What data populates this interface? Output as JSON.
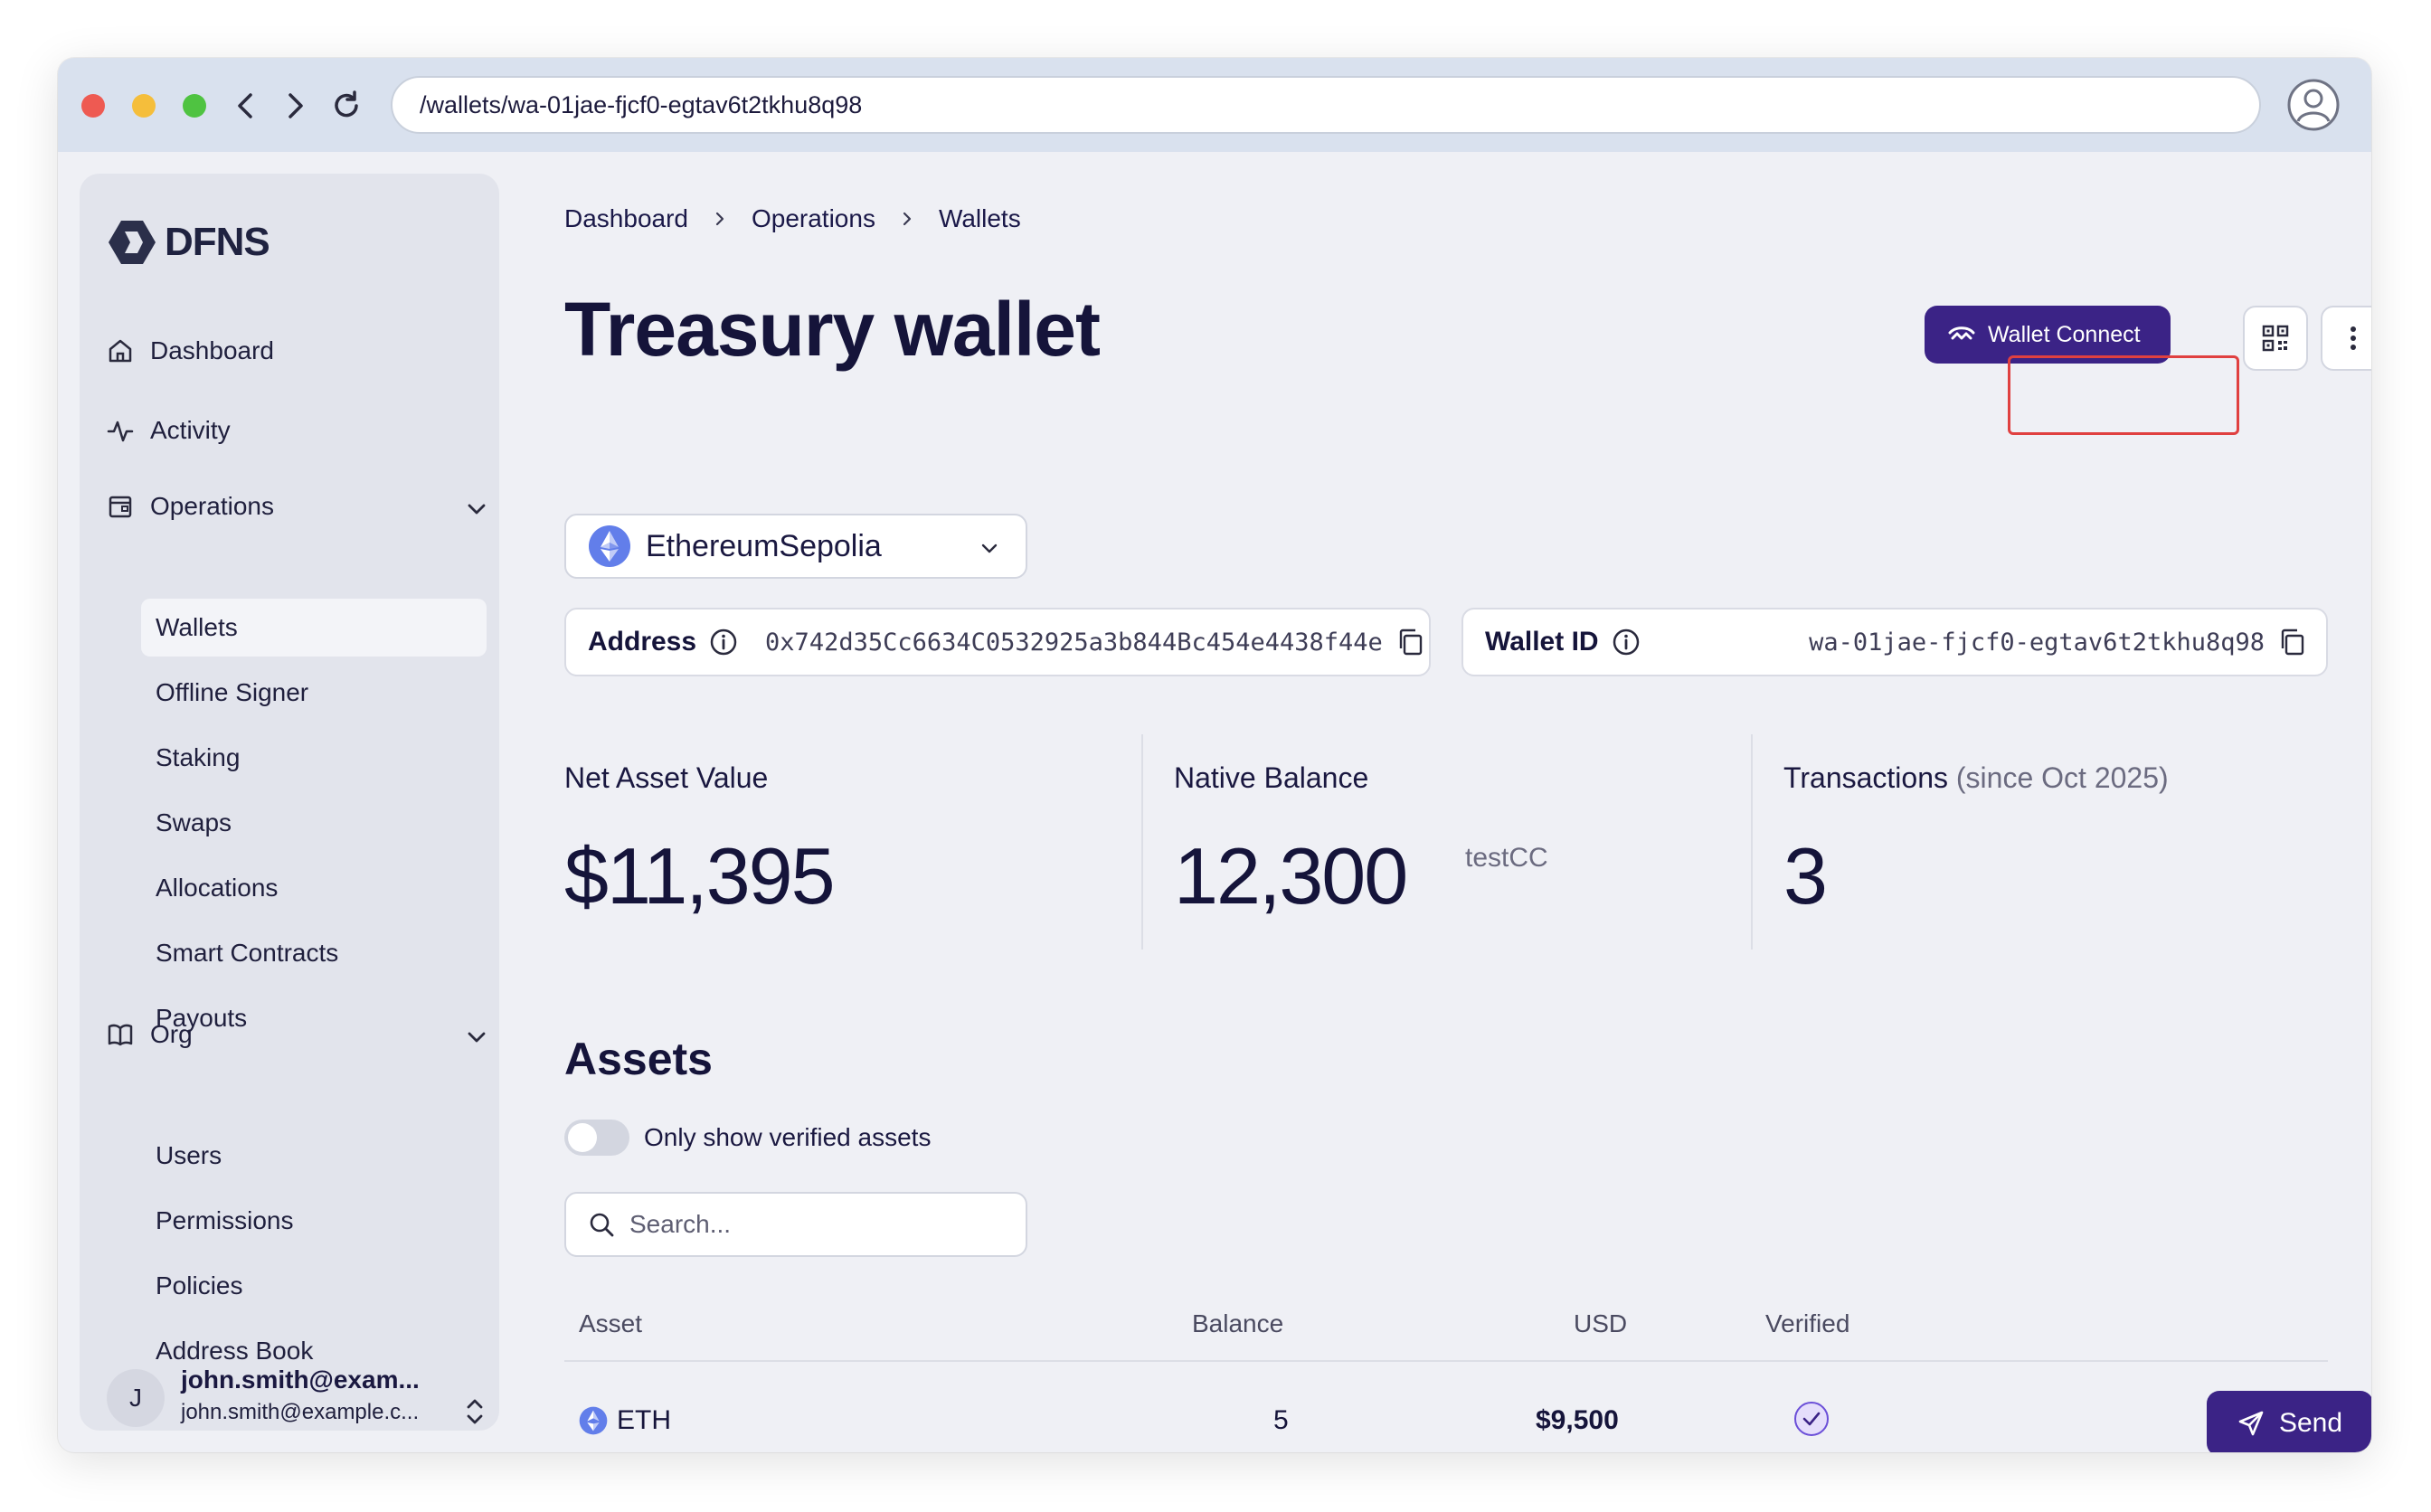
{
  "browser": {
    "url": "/wallets/wa-01jae-fjcf0-egtav6t2tkhu8q98"
  },
  "sidebar": {
    "logo": "DFNS",
    "nav": [
      {
        "label": "Dashboard",
        "icon": "home-icon"
      },
      {
        "label": "Activity",
        "icon": "activity-icon"
      },
      {
        "label": "Operations",
        "icon": "folder-icon"
      }
    ],
    "operations_items": [
      {
        "label": "Wallets",
        "active": true
      },
      {
        "label": "Offline Signer"
      },
      {
        "label": "Staking"
      },
      {
        "label": "Swaps"
      },
      {
        "label": "Allocations"
      },
      {
        "label": "Smart Contracts"
      },
      {
        "label": "Payouts"
      }
    ],
    "org": {
      "label": "Org",
      "icon": "book-icon"
    },
    "org_items": [
      {
        "label": "Users"
      },
      {
        "label": "Permissions"
      },
      {
        "label": "Policies"
      },
      {
        "label": "Address Book"
      }
    ],
    "user": {
      "initial": "J",
      "name": "john.smith@exam...",
      "email": "john.smith@example.c..."
    }
  },
  "breadcrumb": [
    "Dashboard",
    "Operations",
    "Wallets"
  ],
  "page": {
    "title": "Treasury wallet",
    "wallet_connect_label": "Wallet Connect"
  },
  "network": {
    "selected": "EthereumSepolia"
  },
  "address": {
    "label": "Address",
    "value": "0x742d35Cc6634C0532925a3b844Bc454e4438f44e"
  },
  "wallet_id": {
    "label": "Wallet ID",
    "value": "wa-01jae-fjcf0-egtav6t2tkhu8q98"
  },
  "stats": {
    "nav_label": "Net Asset Value",
    "nav_value": "$11,395",
    "native_label": "Native Balance",
    "native_value": "12,300",
    "native_unit": "testCC",
    "tx_label": "Transactions",
    "tx_since": "(since Oct 2025)",
    "tx_value": "3"
  },
  "assets": {
    "title": "Assets",
    "toggle_label": "Only show verified assets",
    "toggle_on": false,
    "search_placeholder": "Search...",
    "columns": [
      "Asset",
      "Balance",
      "USD",
      "Verified"
    ],
    "rows": [
      {
        "asset": "ETH",
        "balance": "5",
        "usd": "$9,500",
        "verified": true,
        "action": "Send"
      }
    ]
  },
  "colors": {
    "primary": "#3b2386",
    "highlight": "#e04040",
    "eth": "#627eea"
  }
}
